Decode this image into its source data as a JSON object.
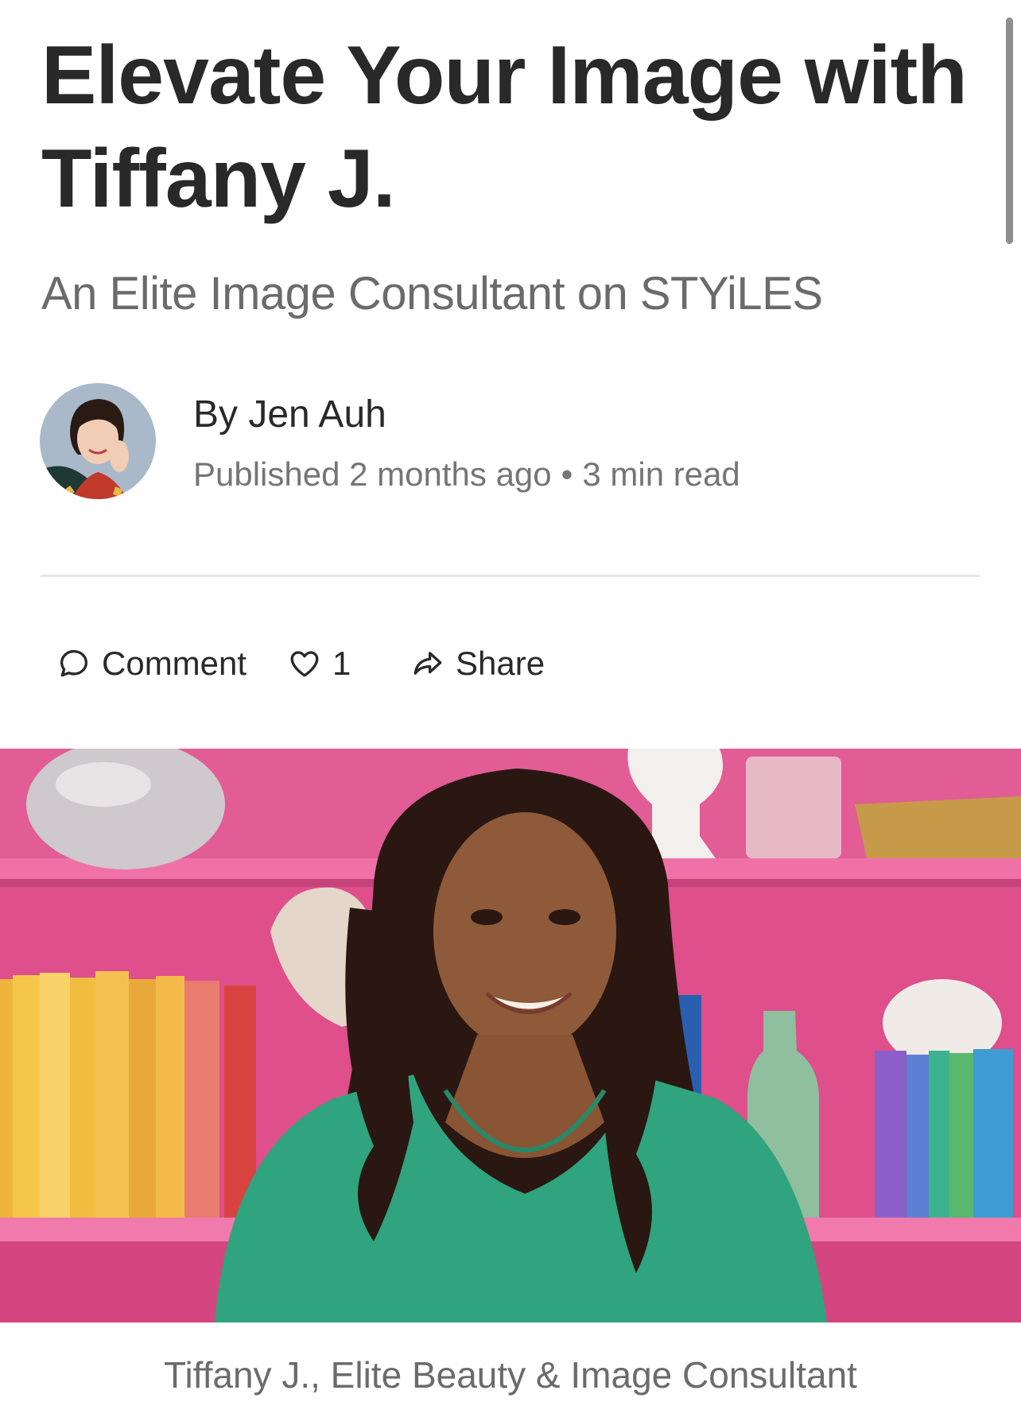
{
  "article": {
    "title": "Elevate Your Image with Tiffany J.",
    "subtitle": "An Elite Image Consultant on STYiLES"
  },
  "author": {
    "byline": "By Jen Auh",
    "published": "Published 2 months ago",
    "separator": "•",
    "read_time": "3 min read"
  },
  "actions": {
    "comment_label": "Comment",
    "like_count": "1",
    "share_label": "Share"
  },
  "hero": {
    "caption": "Tiffany J., Elite Beauty & Image Consultant"
  },
  "icons": {
    "comment": "comment-bubble-icon",
    "like": "heart-icon",
    "share": "share-arrow-icon"
  },
  "colors": {
    "text": "#292929",
    "muted": "#6b6b6b",
    "background_pink": "#e0538a",
    "dress_green": "#2fa47e"
  }
}
